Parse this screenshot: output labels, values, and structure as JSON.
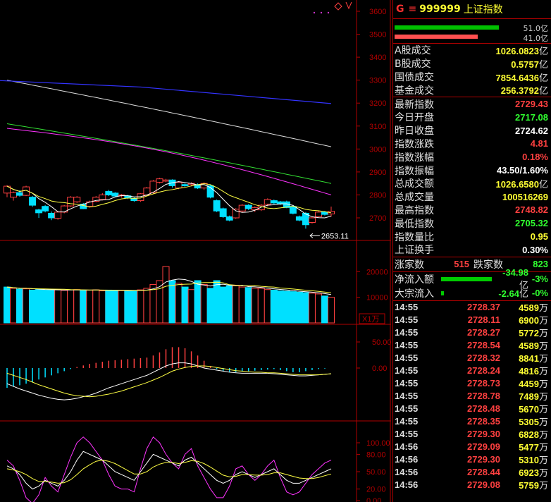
{
  "header": {
    "flag": "G",
    "menu": "≡",
    "code": "999999",
    "name": "上证指数"
  },
  "bars": [
    {
      "value": "51.0亿",
      "color": "#00c000"
    },
    {
      "value": "41.0亿",
      "color": "#ff5050"
    }
  ],
  "turnover": [
    {
      "label": "A股成交",
      "value": "1026.0823",
      "unit": "亿"
    },
    {
      "label": "B股成交",
      "value": "0.5757",
      "unit": "亿"
    },
    {
      "label": "国债成交",
      "value": "7854.6436",
      "unit": "亿"
    },
    {
      "label": "基金成交",
      "value": "256.3792",
      "unit": "亿"
    }
  ],
  "stats": [
    {
      "label": "最新指数",
      "value": "2729.43",
      "color": "red",
      "unit": ""
    },
    {
      "label": "今日开盘",
      "value": "2717.08",
      "color": "grn",
      "unit": ""
    },
    {
      "label": "昨日收盘",
      "value": "2724.62",
      "color": "wht",
      "unit": ""
    },
    {
      "label": "指数涨跌",
      "value": "4.81",
      "color": "red",
      "unit": ""
    },
    {
      "label": "指数涨幅",
      "value": "0.18%",
      "color": "red",
      "unit": ""
    },
    {
      "label": "指数振幅",
      "value": "43.50/1.60%",
      "color": "wht",
      "unit": ""
    },
    {
      "label": "总成交额",
      "value": "1026.6580",
      "color": "ylw",
      "unit": "亿"
    },
    {
      "label": "总成交量",
      "value": "100516269",
      "color": "ylw",
      "unit": ""
    },
    {
      "label": "最高指数",
      "value": "2748.82",
      "color": "red",
      "unit": ""
    },
    {
      "label": "最低指数",
      "value": "2705.32",
      "color": "grn",
      "unit": ""
    },
    {
      "label": "指数量比",
      "value": "0.95",
      "color": "ylw",
      "unit": ""
    },
    {
      "label": "上证换手",
      "value": "0.30%",
      "color": "wht",
      "unit": ""
    }
  ],
  "breadth": {
    "up_label": "涨家数",
    "up_value": "515",
    "down_label": "跌家数",
    "down_value": "823"
  },
  "flows": [
    {
      "label": "净流入额",
      "value": "-34.98",
      "unit": "亿",
      "pct": "-3%",
      "bar": 0.6
    },
    {
      "label": "大宗流入",
      "value": "-2.64",
      "unit": "亿",
      "pct": "-0%",
      "bar": 0.03
    }
  ],
  "ticks": [
    {
      "time": "14:55",
      "price": "2728.37",
      "vol": "4589"
    },
    {
      "time": "14:55",
      "price": "2728.11",
      "vol": "6900"
    },
    {
      "time": "14:55",
      "price": "2728.27",
      "vol": "5772"
    },
    {
      "time": "14:55",
      "price": "2728.54",
      "vol": "4589"
    },
    {
      "time": "14:55",
      "price": "2728.32",
      "vol": "8841"
    },
    {
      "time": "14:55",
      "price": "2728.24",
      "vol": "4816"
    },
    {
      "time": "14:55",
      "price": "2728.73",
      "vol": "4459"
    },
    {
      "time": "14:55",
      "price": "2728.78",
      "vol": "7489"
    },
    {
      "time": "14:55",
      "price": "2728.48",
      "vol": "5670"
    },
    {
      "time": "14:55",
      "price": "2728.35",
      "vol": "5305"
    },
    {
      "time": "14:55",
      "price": "2729.30",
      "vol": "6828"
    },
    {
      "time": "14:56",
      "price": "2729.09",
      "vol": "5477"
    },
    {
      "time": "14:56",
      "price": "2729.30",
      "vol": "5310"
    },
    {
      "time": "14:56",
      "price": "2728.44",
      "vol": "6923"
    },
    {
      "time": "14:56",
      "price": "2729.08",
      "vol": "5759"
    }
  ],
  "tick_vol_unit": "万",
  "chart_data": {
    "type": "candlestick",
    "price_axis": [
      3600,
      3500,
      3400,
      3300,
      3200,
      3100,
      3000,
      2900,
      2800,
      2700
    ],
    "low_annotation": "2653.11",
    "volume_axis": [
      "20000",
      "10000"
    ],
    "volume_unit": "X1万",
    "macd_axis": [
      "50.00",
      "0.00"
    ],
    "kdj_axis": [
      "100.00",
      "80.00",
      "50.00",
      "20.00",
      "0.00"
    ],
    "candles": [
      [
        2808,
        2838,
        2790,
        2842
      ],
      [
        2790,
        2810,
        2775,
        2815
      ],
      [
        2810,
        2798,
        2792,
        2820
      ],
      [
        2798,
        2835,
        2795,
        2840
      ],
      [
        2790,
        2755,
        2748,
        2795
      ],
      [
        2735,
        2722,
        2700,
        2740
      ],
      [
        2750,
        2730,
        2724,
        2756
      ],
      [
        2720,
        2700,
        2690,
        2728
      ],
      [
        2698,
        2725,
        2692,
        2730
      ],
      [
        2725,
        2752,
        2720,
        2756
      ],
      [
        2752,
        2790,
        2748,
        2795
      ],
      [
        2770,
        2790,
        2765,
        2795
      ],
      [
        2760,
        2740,
        2738,
        2765
      ],
      [
        2750,
        2770,
        2745,
        2775
      ],
      [
        2772,
        2790,
        2768,
        2795
      ],
      [
        2780,
        2800,
        2776,
        2808
      ],
      [
        2815,
        2800,
        2795,
        2822
      ],
      [
        2808,
        2795,
        2792,
        2812
      ],
      [
        2796,
        2800,
        2788,
        2804
      ],
      [
        2796,
        2788,
        2782,
        2800
      ],
      [
        2785,
        2775,
        2770,
        2790
      ],
      [
        2775,
        2805,
        2770,
        2808
      ],
      [
        2800,
        2830,
        2795,
        2835
      ],
      [
        2810,
        2860,
        2805,
        2865
      ],
      [
        2855,
        2870,
        2850,
        2874
      ],
      [
        2860,
        2865,
        2855,
        2870
      ],
      [
        2865,
        2840,
        2832,
        2868
      ],
      [
        2830,
        2855,
        2825,
        2860
      ],
      [
        2845,
        2840,
        2835,
        2850
      ],
      [
        2845,
        2850,
        2838,
        2855
      ],
      [
        2845,
        2830,
        2826,
        2850
      ],
      [
        2830,
        2850,
        2822,
        2855
      ],
      [
        2840,
        2790,
        2785,
        2845
      ],
      [
        2775,
        2730,
        2725,
        2780
      ],
      [
        2740,
        2705,
        2700,
        2745
      ],
      [
        2705,
        2690,
        2685,
        2710
      ],
      [
        2700,
        2738,
        2696,
        2742
      ],
      [
        2730,
        2755,
        2725,
        2760
      ],
      [
        2755,
        2740,
        2734,
        2760
      ],
      [
        2735,
        2745,
        2725,
        2750
      ],
      [
        2735,
        2755,
        2730,
        2760
      ],
      [
        2760,
        2780,
        2750,
        2785
      ],
      [
        2775,
        2765,
        2760,
        2780
      ],
      [
        2770,
        2760,
        2756,
        2774
      ],
      [
        2770,
        2745,
        2742,
        2775
      ],
      [
        2750,
        2720,
        2715,
        2755
      ],
      [
        2705,
        2690,
        2685,
        2710
      ],
      [
        2720,
        2670,
        2653,
        2725
      ],
      [
        2680,
        2700,
        2675,
        2705
      ],
      [
        2705,
        2725,
        2700,
        2730
      ],
      [
        2725,
        2715,
        2710,
        2730
      ],
      [
        2717,
        2729,
        2705,
        2749
      ]
    ],
    "volumes": [
      14000,
      13500,
      13200,
      13300,
      12800,
      13000,
      12900,
      12800,
      13000,
      12700,
      12900,
      13000,
      12600,
      12800,
      12900,
      12500,
      12800,
      12700,
      12600,
      12400,
      12600,
      12900,
      13500,
      15000,
      16500,
      22000,
      16500,
      15500,
      14000,
      13000,
      16500,
      15000,
      13500,
      16500,
      14000,
      14500,
      14500,
      14000,
      13800,
      13500,
      13500,
      13000,
      12800,
      12500,
      12400,
      12200,
      12000,
      11800,
      11600,
      11300,
      10500,
      10000
    ],
    "vol_up_flags": [
      0,
      1,
      0,
      1,
      0,
      0,
      0,
      0,
      1,
      1,
      1,
      1,
      0,
      1,
      1,
      1,
      0,
      0,
      1,
      0,
      0,
      1,
      1,
      1,
      1,
      1,
      0,
      1,
      0,
      1,
      0,
      1,
      0,
      0,
      0,
      0,
      1,
      1,
      0,
      1,
      1,
      1,
      0,
      0,
      0,
      0,
      0,
      0,
      1,
      1,
      0,
      1
    ],
    "macd_hist": [
      -38,
      -36,
      -33,
      -30,
      -27,
      -22,
      -18,
      -14,
      -10,
      -6,
      -2,
      2,
      5,
      8,
      10,
      12,
      14,
      15,
      16,
      17,
      18,
      19,
      20,
      24,
      30,
      36,
      40,
      40,
      38,
      32,
      24,
      14,
      4,
      -2,
      -6,
      -8,
      -8,
      -7,
      -6,
      -5,
      -4,
      -3,
      -2,
      -4,
      -6,
      -8,
      -8,
      -6,
      -4,
      -2,
      -1,
      0
    ],
    "macd_dif": [
      -30,
      -35,
      -40,
      -44,
      -48,
      -52,
      -55,
      -58,
      -60,
      -61,
      -60,
      -58,
      -55,
      -52,
      -48,
      -43,
      -38,
      -34,
      -30,
      -26,
      -22,
      -18,
      -14,
      -8,
      -2,
      4,
      8,
      10,
      10,
      8,
      4,
      0,
      -2,
      -4,
      -6,
      -8,
      -9,
      -10,
      -10,
      -10,
      -10,
      -10,
      -11,
      -12,
      -13,
      -14,
      -15,
      -15,
      -14,
      -13,
      -12,
      -11
    ],
    "macd_dea": [
      -10,
      -14,
      -18,
      -22,
      -27,
      -32,
      -36,
      -40,
      -44,
      -48,
      -51,
      -53,
      -54,
      -55,
      -54,
      -52,
      -50,
      -47,
      -44,
      -40,
      -36,
      -32,
      -28,
      -23,
      -18,
      -12,
      -6,
      -2,
      1,
      3,
      4,
      4,
      3,
      1,
      -1,
      -3,
      -5,
      -6,
      -7,
      -8,
      -8,
      -9,
      -9,
      -10,
      -11,
      -12,
      -13,
      -13,
      -13,
      -13,
      -12,
      -11
    ],
    "kdj_k": [
      60,
      55,
      45,
      30,
      20,
      25,
      35,
      30,
      25,
      35,
      50,
      70,
      85,
      80,
      75,
      70,
      60,
      50,
      45,
      40,
      35,
      50,
      65,
      80,
      75,
      70,
      65,
      60,
      70,
      75,
      65,
      55,
      45,
      35,
      30,
      35,
      45,
      50,
      45,
      40,
      45,
      50,
      55,
      45,
      35,
      30,
      30,
      35,
      40,
      45,
      50,
      55
    ],
    "kdj_d": [
      55,
      53,
      50,
      45,
      38,
      33,
      33,
      32,
      30,
      31,
      36,
      45,
      55,
      62,
      68,
      70,
      68,
      64,
      58,
      52,
      46,
      46,
      50,
      58,
      63,
      66,
      66,
      64,
      66,
      69,
      68,
      64,
      58,
      51,
      44,
      41,
      42,
      45,
      45,
      44,
      44,
      45,
      48,
      48,
      45,
      42,
      39,
      38,
      38,
      40,
      43,
      46
    ],
    "kdj_j": [
      70,
      60,
      35,
      5,
      -5,
      10,
      40,
      25,
      15,
      45,
      75,
      100,
      110,
      100,
      85,
      70,
      45,
      25,
      20,
      20,
      15,
      55,
      90,
      110,
      100,
      80,
      65,
      55,
      80,
      90,
      60,
      40,
      20,
      5,
      5,
      25,
      55,
      60,
      45,
      35,
      45,
      60,
      70,
      40,
      15,
      10,
      15,
      30,
      45,
      55,
      65,
      70
    ]
  }
}
